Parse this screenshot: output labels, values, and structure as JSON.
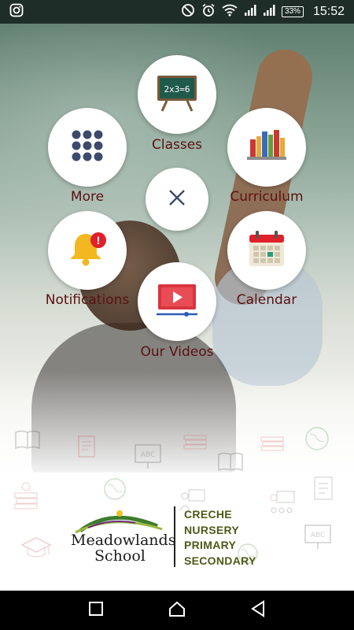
{
  "status_bar": {
    "time": "15:52",
    "battery": "33%",
    "icons": [
      "instagram-icon",
      "dnd-icon",
      "alarm-icon",
      "wifi-icon",
      "signal-icon",
      "signal-icon-2",
      "battery-icon"
    ]
  },
  "menu": {
    "items": [
      {
        "label": "Classes",
        "icon": "chalkboard-icon"
      },
      {
        "label": "More",
        "icon": "grid-dots-icon"
      },
      {
        "label": "Curriculum",
        "icon": "books-icon"
      },
      {
        "label": "Notifications",
        "icon": "bell-icon"
      },
      {
        "label": "Calendar",
        "icon": "calendar-icon"
      },
      {
        "label": "Our Videos",
        "icon": "video-player-icon"
      }
    ],
    "close_icon": "close-icon",
    "chalkboard_text": "2x3=6",
    "notification_badge": "!"
  },
  "footer": {
    "logo": {
      "name_line1": "Meadowlands",
      "name_line2": "School"
    },
    "levels": [
      "CRECHE",
      "NURSERY",
      "PRIMARY",
      "SECONDARY"
    ]
  },
  "nav_bar": {
    "buttons": [
      "recent-apps-icon",
      "home-icon",
      "back-icon"
    ]
  },
  "colors": {
    "label": "#5a1111",
    "levels": "#4e5a18",
    "status_bar": "#1f2d29"
  }
}
